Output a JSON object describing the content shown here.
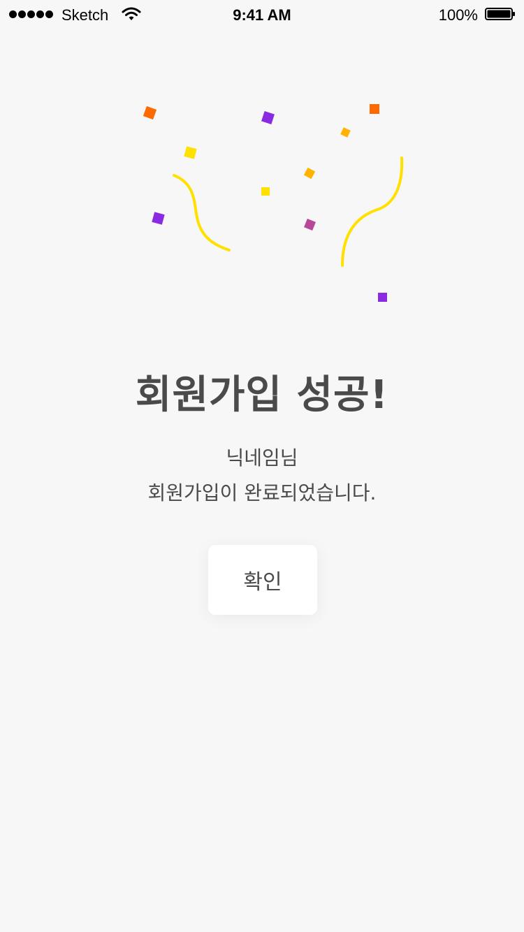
{
  "status_bar": {
    "carrier": "Sketch",
    "time": "9:41 AM",
    "battery": "100%"
  },
  "icons": {
    "signal": "signal-dots-icon",
    "wifi": "wifi-icon",
    "battery": "battery-icon",
    "confetti": "confetti-icon"
  },
  "colors": {
    "orange": "#ff6a00",
    "purple": "#8a2be2",
    "yellow": "#ffe000",
    "amber": "#ffb300",
    "magenta": "#b8479a",
    "text": "#4a4a4a",
    "background": "#f7f7f7"
  },
  "main": {
    "title": "회원가입 성공!",
    "nickname_line": "닉네임님",
    "message_line": "회원가입이 완료되었습니다.",
    "confirm_label": "확인"
  }
}
